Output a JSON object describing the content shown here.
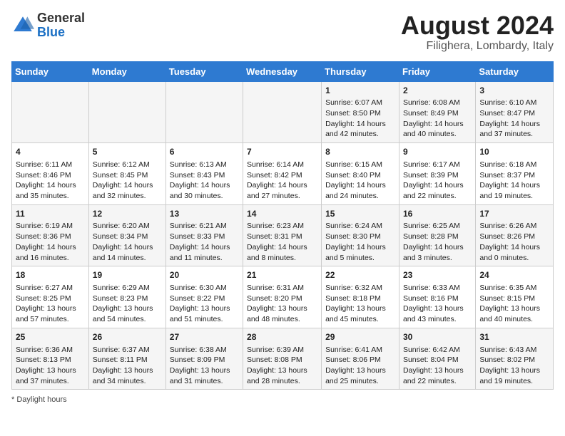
{
  "header": {
    "logo_general": "General",
    "logo_blue": "Blue",
    "month_year": "August 2024",
    "location": "Filighera, Lombardy, Italy"
  },
  "days_of_week": [
    "Sunday",
    "Monday",
    "Tuesday",
    "Wednesday",
    "Thursday",
    "Friday",
    "Saturday"
  ],
  "weeks": [
    [
      {
        "day": "",
        "sunrise": "",
        "sunset": "",
        "daylight": ""
      },
      {
        "day": "",
        "sunrise": "",
        "sunset": "",
        "daylight": ""
      },
      {
        "day": "",
        "sunrise": "",
        "sunset": "",
        "daylight": ""
      },
      {
        "day": "",
        "sunrise": "",
        "sunset": "",
        "daylight": ""
      },
      {
        "day": "1",
        "sunrise": "6:07 AM",
        "sunset": "8:50 PM",
        "daylight": "14 hours and 42 minutes."
      },
      {
        "day": "2",
        "sunrise": "6:08 AM",
        "sunset": "8:49 PM",
        "daylight": "14 hours and 40 minutes."
      },
      {
        "day": "3",
        "sunrise": "6:10 AM",
        "sunset": "8:47 PM",
        "daylight": "14 hours and 37 minutes."
      }
    ],
    [
      {
        "day": "4",
        "sunrise": "6:11 AM",
        "sunset": "8:46 PM",
        "daylight": "14 hours and 35 minutes."
      },
      {
        "day": "5",
        "sunrise": "6:12 AM",
        "sunset": "8:45 PM",
        "daylight": "14 hours and 32 minutes."
      },
      {
        "day": "6",
        "sunrise": "6:13 AM",
        "sunset": "8:43 PM",
        "daylight": "14 hours and 30 minutes."
      },
      {
        "day": "7",
        "sunrise": "6:14 AM",
        "sunset": "8:42 PM",
        "daylight": "14 hours and 27 minutes."
      },
      {
        "day": "8",
        "sunrise": "6:15 AM",
        "sunset": "8:40 PM",
        "daylight": "14 hours and 24 minutes."
      },
      {
        "day": "9",
        "sunrise": "6:17 AM",
        "sunset": "8:39 PM",
        "daylight": "14 hours and 22 minutes."
      },
      {
        "day": "10",
        "sunrise": "6:18 AM",
        "sunset": "8:37 PM",
        "daylight": "14 hours and 19 minutes."
      }
    ],
    [
      {
        "day": "11",
        "sunrise": "6:19 AM",
        "sunset": "8:36 PM",
        "daylight": "14 hours and 16 minutes."
      },
      {
        "day": "12",
        "sunrise": "6:20 AM",
        "sunset": "8:34 PM",
        "daylight": "14 hours and 14 minutes."
      },
      {
        "day": "13",
        "sunrise": "6:21 AM",
        "sunset": "8:33 PM",
        "daylight": "14 hours and 11 minutes."
      },
      {
        "day": "14",
        "sunrise": "6:23 AM",
        "sunset": "8:31 PM",
        "daylight": "14 hours and 8 minutes."
      },
      {
        "day": "15",
        "sunrise": "6:24 AM",
        "sunset": "8:30 PM",
        "daylight": "14 hours and 5 minutes."
      },
      {
        "day": "16",
        "sunrise": "6:25 AM",
        "sunset": "8:28 PM",
        "daylight": "14 hours and 3 minutes."
      },
      {
        "day": "17",
        "sunrise": "6:26 AM",
        "sunset": "8:26 PM",
        "daylight": "14 hours and 0 minutes."
      }
    ],
    [
      {
        "day": "18",
        "sunrise": "6:27 AM",
        "sunset": "8:25 PM",
        "daylight": "13 hours and 57 minutes."
      },
      {
        "day": "19",
        "sunrise": "6:29 AM",
        "sunset": "8:23 PM",
        "daylight": "13 hours and 54 minutes."
      },
      {
        "day": "20",
        "sunrise": "6:30 AM",
        "sunset": "8:22 PM",
        "daylight": "13 hours and 51 minutes."
      },
      {
        "day": "21",
        "sunrise": "6:31 AM",
        "sunset": "8:20 PM",
        "daylight": "13 hours and 48 minutes."
      },
      {
        "day": "22",
        "sunrise": "6:32 AM",
        "sunset": "8:18 PM",
        "daylight": "13 hours and 45 minutes."
      },
      {
        "day": "23",
        "sunrise": "6:33 AM",
        "sunset": "8:16 PM",
        "daylight": "13 hours and 43 minutes."
      },
      {
        "day": "24",
        "sunrise": "6:35 AM",
        "sunset": "8:15 PM",
        "daylight": "13 hours and 40 minutes."
      }
    ],
    [
      {
        "day": "25",
        "sunrise": "6:36 AM",
        "sunset": "8:13 PM",
        "daylight": "13 hours and 37 minutes."
      },
      {
        "day": "26",
        "sunrise": "6:37 AM",
        "sunset": "8:11 PM",
        "daylight": "13 hours and 34 minutes."
      },
      {
        "day": "27",
        "sunrise": "6:38 AM",
        "sunset": "8:09 PM",
        "daylight": "13 hours and 31 minutes."
      },
      {
        "day": "28",
        "sunrise": "6:39 AM",
        "sunset": "8:08 PM",
        "daylight": "13 hours and 28 minutes."
      },
      {
        "day": "29",
        "sunrise": "6:41 AM",
        "sunset": "8:06 PM",
        "daylight": "13 hours and 25 minutes."
      },
      {
        "day": "30",
        "sunrise": "6:42 AM",
        "sunset": "8:04 PM",
        "daylight": "13 hours and 22 minutes."
      },
      {
        "day": "31",
        "sunrise": "6:43 AM",
        "sunset": "8:02 PM",
        "daylight": "13 hours and 19 minutes."
      }
    ]
  ],
  "footer": {
    "note": "Daylight hours"
  }
}
